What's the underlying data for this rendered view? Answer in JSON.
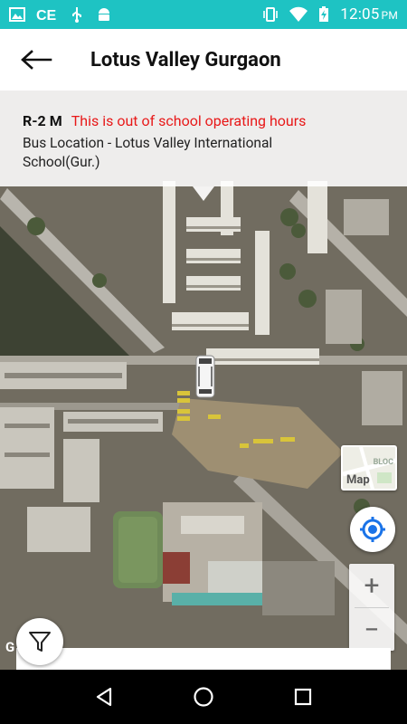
{
  "status_bar": {
    "time": "12:05",
    "ampm": "PM",
    "icons": [
      "image-icon",
      "cc-icon",
      "usb-icon",
      "android-icon",
      "vibrate-icon",
      "wifi-icon",
      "battery-charging-icon"
    ]
  },
  "app_bar": {
    "title": "Lotus Valley Gurgaon",
    "back_icon": "arrow-back-icon"
  },
  "info_panel": {
    "route_code": "R-2 M",
    "warning": "This is out of school operating hours",
    "bus_location": "Bus Location - Lotus Valley International School(Gur.)"
  },
  "map": {
    "map_type_label": "Map",
    "map_type_mini_text": "BLOC",
    "zoom_in": "+",
    "zoom_out": "−",
    "attribution": "G"
  },
  "nav_bar": {
    "icons": [
      "back-triangle-icon",
      "home-circle-icon",
      "recents-square-icon"
    ]
  },
  "colors": {
    "status_bar": "#1ec3c3",
    "warning": "#e81818",
    "locate_accent": "#1a73e8"
  }
}
